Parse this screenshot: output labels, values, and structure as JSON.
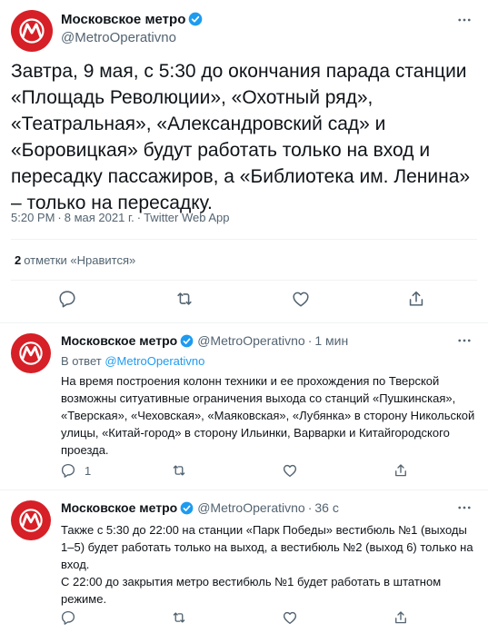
{
  "main_tweet": {
    "author_name": "Московское метро",
    "handle": "@MetroOperativno",
    "text": "Завтра, 9 мая, с 5:30 до окончания парада станции «Площадь Революции», «Охотный ряд», «Театральная», «Александровский сад» и «Боровицкая» будут работать только на вход и пересадку пассажиров, а «Библиотека им. Ленина» – только на пересадку.",
    "time": "5:20 PM",
    "date": "8 мая 2021 г.",
    "source": "Twitter Web App",
    "likes_count": "2",
    "likes_label": "отметки «Нравится»"
  },
  "replies": [
    {
      "author_name": "Московское метро",
      "handle": "@MetroOperativno",
      "time": "1 мин",
      "reply_to_prefix": "В ответ",
      "reply_to_handle": "@MetroOperativno",
      "text": "На время построения колонн техники и ее прохождения по Тверской возможны ситуативные ограничения выхода со станций «Пушкинская», «Тверская», «Чеховская», «Маяковская», «Лубянка» в сторону Никольской улицы, «Китай-город» в сторону Ильинки, Варварки и Китайгородского проезда.",
      "reply_count": "1"
    },
    {
      "author_name": "Московское метро",
      "handle": "@MetroOperativno",
      "time": "36 с",
      "text": "Также с 5:30 до 22:00 на станции «Парк Победы» вестибюль №1 (выходы 1–5) будет работать только на выход, а вестибюль №2 (выход 6) только на вход.\nС 22:00 до закрытия метро вестибюль №1 будет работать в штатном режиме.",
      "reply_count": ""
    }
  ],
  "colors": {
    "brand_red": "#d61f26",
    "verified_blue": "#1d9bf0",
    "secondary_text": "#536471"
  },
  "icons": [
    "metro-logo-icon",
    "verified-badge-icon",
    "more-icon",
    "reply-icon",
    "retweet-icon",
    "like-icon",
    "share-icon"
  ]
}
